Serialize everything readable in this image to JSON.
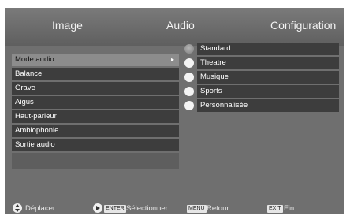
{
  "tabs": [
    "Image",
    "Audio",
    "Configuration"
  ],
  "menu": {
    "items": [
      {
        "label": "Mode audio",
        "selected": true,
        "has_arrow": true
      },
      {
        "label": "Balance"
      },
      {
        "label": "Grave"
      },
      {
        "label": "Aigus"
      },
      {
        "label": "Haut-parleur"
      },
      {
        "label": "Ambiophonie"
      },
      {
        "label": "Sortie audio"
      }
    ],
    "arrow_glyph": "▸"
  },
  "options": {
    "items": [
      {
        "label": "Standard",
        "selected": true
      },
      {
        "label": "Theatre"
      },
      {
        "label": "Musique"
      },
      {
        "label": "Sports"
      },
      {
        "label": "Personnalisée"
      }
    ]
  },
  "footer": {
    "move": "Déplacer",
    "enter_key": "ENTER",
    "select": "Sélectionner",
    "menu_key": "MENU",
    "back": "Retour",
    "exit_key": "EXIT",
    "end": "Fin"
  }
}
